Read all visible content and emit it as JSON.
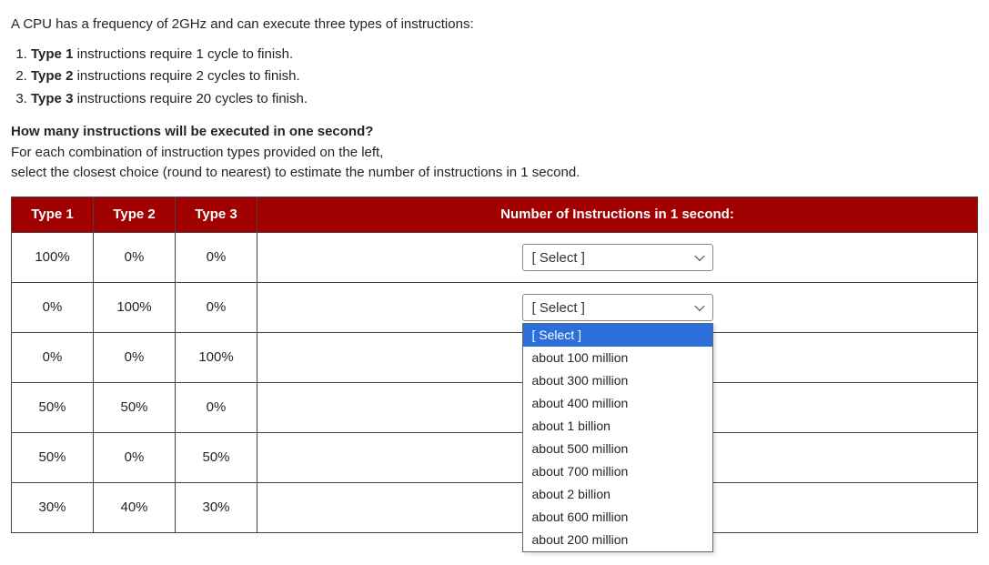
{
  "intro": "A CPU has a frequency of 2GHz and can execute three types of instructions:",
  "spec": [
    {
      "bold": "Type 1",
      "rest": " instructions require 1 cycle to finish."
    },
    {
      "bold": "Type 2",
      "rest": " instructions require 2 cycles to finish."
    },
    {
      "bold": "Type 3",
      "rest": " instructions require 20 cycles to finish."
    }
  ],
  "question": {
    "title": "How many instructions will be executed in one second?",
    "line1": "For each combination of instruction types provided on the left,",
    "line2": "select the closest choice (round to nearest) to estimate the number of instructions in 1 second."
  },
  "headers": {
    "t1": "Type 1",
    "t2": "Type 2",
    "t3": "Type 3",
    "ans": "Number of Instructions in 1 second:"
  },
  "rows": [
    {
      "t1": "100%",
      "t2": "0%",
      "t3": "0%"
    },
    {
      "t1": "0%",
      "t2": "100%",
      "t3": "0%"
    },
    {
      "t1": "0%",
      "t2": "0%",
      "t3": "100%"
    },
    {
      "t1": "50%",
      "t2": "50%",
      "t3": "0%"
    },
    {
      "t1": "50%",
      "t2": "0%",
      "t3": "50%"
    },
    {
      "t1": "30%",
      "t2": "40%",
      "t3": "30%"
    }
  ],
  "select_placeholder": "[ Select ]",
  "dropdown_open_row": 1,
  "options": [
    "[ Select ]",
    "about 100 million",
    "about 300 million",
    "about 400 million",
    "about 1 billion",
    "about 500 million",
    "about 700 million",
    "about 2 billion",
    "about 600 million",
    "about 200 million"
  ],
  "highlighted_option_index": 0
}
